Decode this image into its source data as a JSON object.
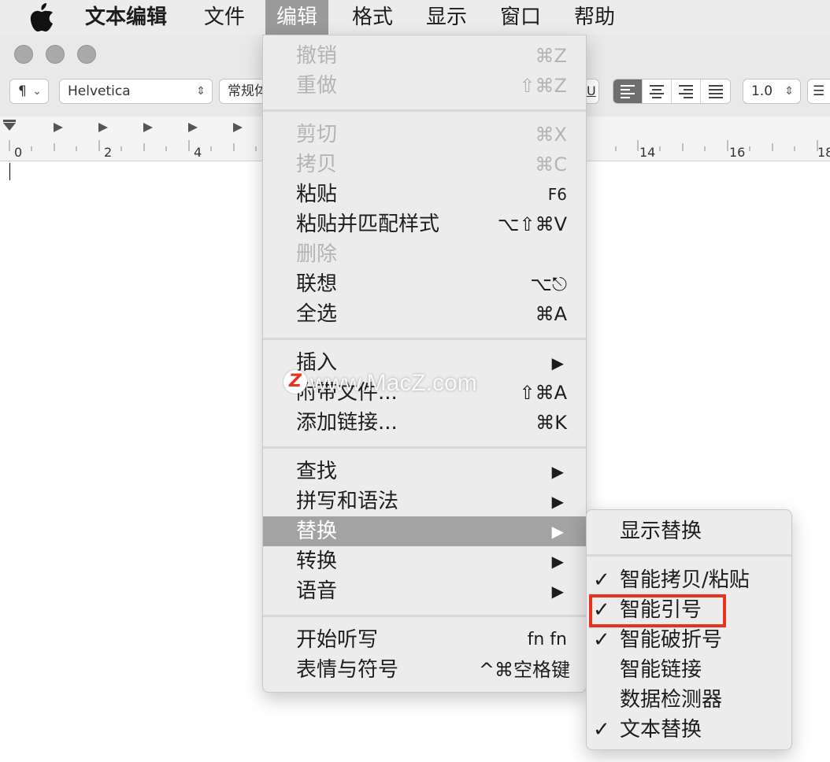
{
  "menubar": {
    "app_name": "文本编辑",
    "items": [
      "文件",
      "编辑",
      "格式",
      "显示",
      "窗口",
      "帮助"
    ],
    "active": "编辑"
  },
  "toolbar": {
    "paragraph": "¶",
    "font_family": "Helvetica",
    "font_style": "常规体",
    "line_spacing": "1.0"
  },
  "ruler": {
    "labels": [
      "0",
      "2",
      "4",
      "14",
      "16",
      "18"
    ]
  },
  "edit_menu": {
    "undo": {
      "label": "撤销",
      "shortcut": "⌘Z"
    },
    "redo": {
      "label": "重做",
      "shortcut": "⇧⌘Z"
    },
    "cut": {
      "label": "剪切",
      "shortcut": "⌘X"
    },
    "copy": {
      "label": "拷贝",
      "shortcut": "⌘C"
    },
    "paste": {
      "label": "粘贴",
      "shortcut": "F6"
    },
    "paste_match": {
      "label": "粘贴并匹配样式",
      "shortcut": "⌥⇧⌘V"
    },
    "delete": {
      "label": "删除"
    },
    "complete": {
      "label": "联想",
      "shortcut": "⌥⎋"
    },
    "select_all": {
      "label": "全选",
      "shortcut": "⌘A"
    },
    "insert": {
      "label": "插入"
    },
    "attach": {
      "label": "附带文件...",
      "shortcut": "⇧⌘A"
    },
    "add_link": {
      "label": "添加链接...",
      "shortcut": "⌘K"
    },
    "find": {
      "label": "查找"
    },
    "spelling": {
      "label": "拼写和语法"
    },
    "substitutions": {
      "label": "替换"
    },
    "transformations": {
      "label": "转换"
    },
    "speech": {
      "label": "语音"
    },
    "dictation": {
      "label": "开始听写",
      "shortcut": "fn fn"
    },
    "emoji": {
      "label": "表情与符号",
      "shortcut": "^⌘空格键"
    }
  },
  "substitutions_menu": {
    "show": "显示替换",
    "items": [
      {
        "label": "智能拷贝/粘贴",
        "checked": "✓"
      },
      {
        "label": "智能引号",
        "checked": "✓"
      },
      {
        "label": "智能破折号",
        "checked": "✓"
      },
      {
        "label": "智能链接",
        "checked": ""
      },
      {
        "label": "数据检测器",
        "checked": ""
      },
      {
        "label": "文本替换",
        "checked": "✓"
      }
    ]
  },
  "watermark": {
    "text": "www.MacZ.com",
    "logo": "Z"
  },
  "colors": {
    "highlight": "#a3a3a3",
    "annotation": "#e8321e"
  }
}
